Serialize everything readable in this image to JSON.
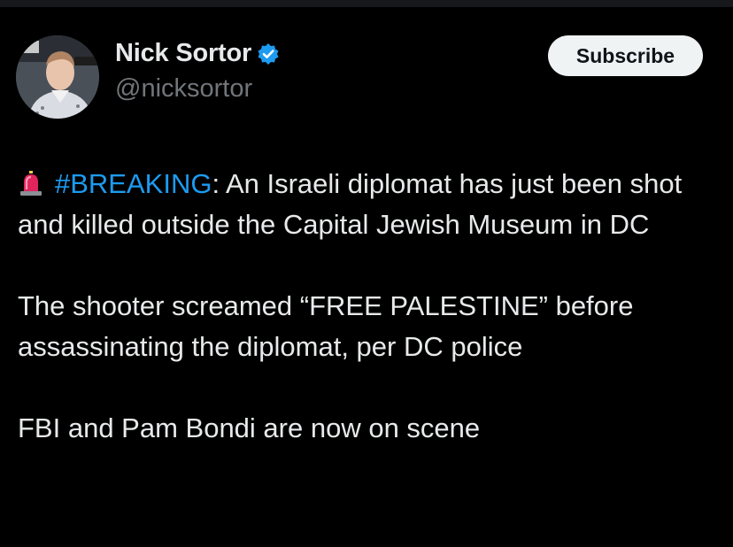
{
  "author": {
    "display_name": "Nick Sortor",
    "handle": "@nicksortor",
    "verified": true,
    "avatar_label": "profile-photo"
  },
  "actions": {
    "subscribe_label": "Subscribe"
  },
  "tweet": {
    "emoji": "siren-icon",
    "hashtag": "#BREAKING",
    "line1_rest": ": An Israeli diplomat has just been shot and killed outside the Capital Jewish Museum in DC",
    "paragraph2": "The shooter screamed “FREE PALESTINE” before assassinating the diplomat, per DC police",
    "paragraph3": "FBI and Pam Bondi are now on scene"
  },
  "colors": {
    "background": "#000000",
    "text": "#e7e9ea",
    "secondary_text": "#71767b",
    "link": "#1d9bf0",
    "verified_badge": "#1d9bf0",
    "button_bg": "#eff3f4"
  }
}
